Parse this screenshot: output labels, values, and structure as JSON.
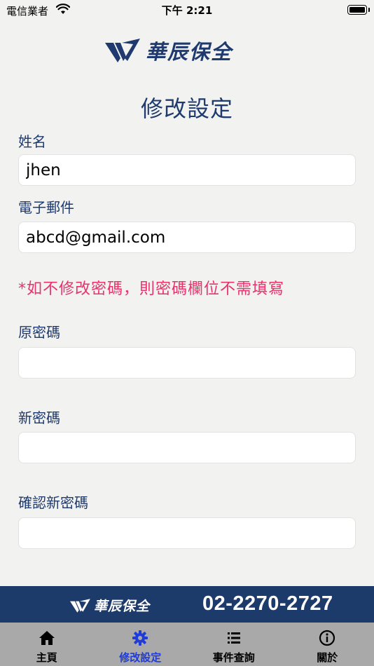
{
  "status_bar": {
    "carrier": "電信業者",
    "time": "下午 2:21"
  },
  "header": {
    "brand": "華辰保全"
  },
  "page": {
    "title": "修改設定"
  },
  "form": {
    "name_label": "姓名",
    "name_value": "jhen",
    "email_label": "電子郵件",
    "email_value": "abcd@gmail.com",
    "notice": "*如不修改密碼，則密碼欄位不需填寫",
    "old_password_label": "原密碼",
    "new_password_label": "新密碼",
    "confirm_password_label": "確認新密碼"
  },
  "footer": {
    "brand": "華辰保全",
    "phone": "02-2270-2727"
  },
  "tabs": [
    {
      "label": "主頁",
      "icon": "home-icon",
      "active": false
    },
    {
      "label": "修改設定",
      "icon": "gear-icon",
      "active": true
    },
    {
      "label": "事件查詢",
      "icon": "list-icon",
      "active": false
    },
    {
      "label": "關於",
      "icon": "info-icon",
      "active": false
    }
  ],
  "colors": {
    "brand": "#1e3a6e",
    "notice": "#e8336b",
    "tab_active": "#1f3bd9",
    "tabbar": "#a9a9a9"
  }
}
